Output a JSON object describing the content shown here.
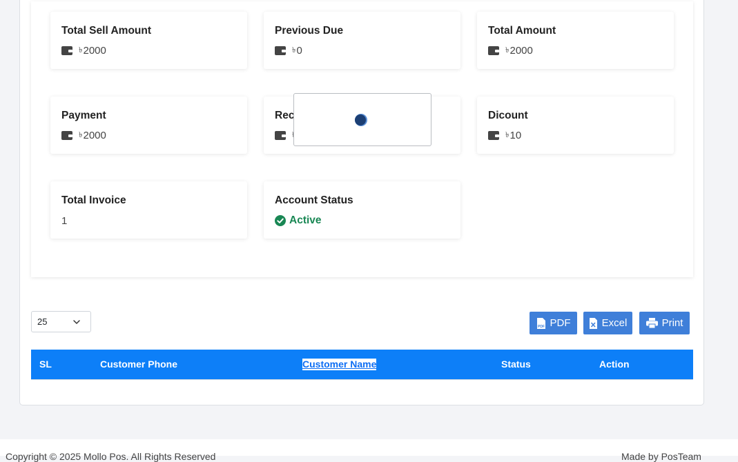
{
  "cards": {
    "total_sell": {
      "title": "Total Sell Amount",
      "currency": "৳",
      "value": "2000"
    },
    "previous_due": {
      "title": "Previous Due",
      "currency": "৳",
      "value": "0"
    },
    "total_amount": {
      "title": "Total Amount",
      "currency": "৳",
      "value": "2000"
    },
    "payment": {
      "title": "Payment",
      "currency": "৳",
      "value": "2000"
    },
    "received": {
      "title": "Rec",
      "currency": "৳",
      "value": ""
    },
    "discount": {
      "title": "Dicount",
      "currency": "৳",
      "value": "10"
    },
    "total_invoice": {
      "title": "Total Invoice",
      "value": "1"
    },
    "account_status": {
      "title": "Account Status",
      "value": "Active"
    }
  },
  "table_controls": {
    "page_size": "25",
    "pdf_label": "PDF",
    "excel_label": "Excel",
    "print_label": "Print"
  },
  "table": {
    "columns": [
      "SL",
      "Customer Phone",
      "Customer Name",
      "Status",
      "Action"
    ]
  },
  "footer": {
    "left": "Copyright © 2025 Mollo Pos. All Rights Reserved",
    "right": "Made by PosTeam"
  },
  "colors": {
    "table_header": "#0d7ff8",
    "button": "#3f7fd9",
    "active_status": "#198754"
  }
}
